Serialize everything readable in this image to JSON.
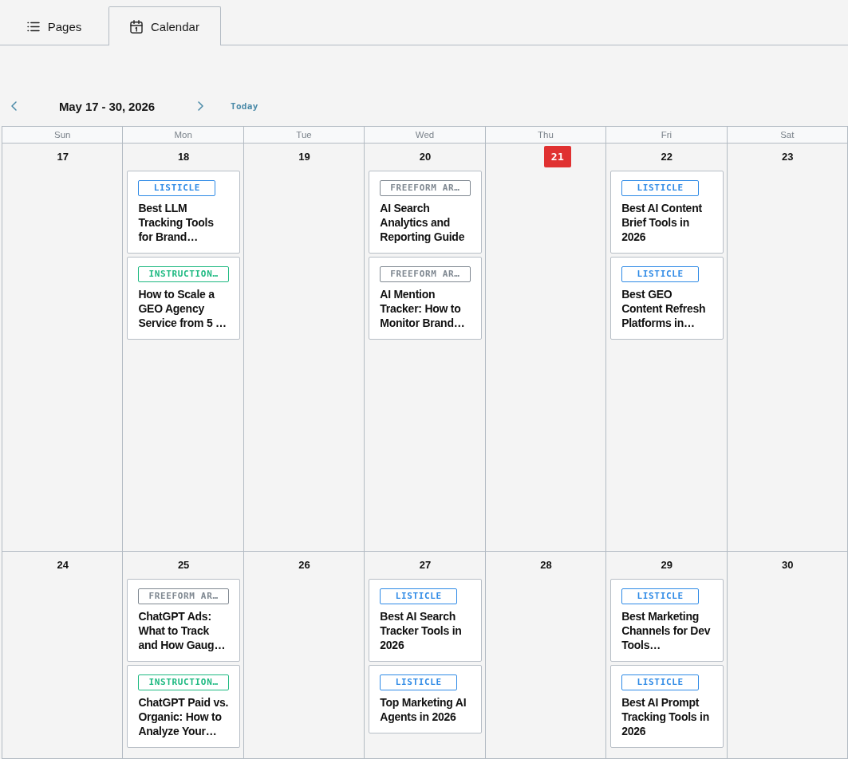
{
  "tabs": [
    {
      "label": "Pages",
      "selected": false
    },
    {
      "label": "Calendar",
      "selected": true
    }
  ],
  "navigation": {
    "range": "May 17 - 30, 2026",
    "today_button": "Today"
  },
  "calendar": {
    "weekdays": [
      "Sun",
      "Mon",
      "Tue",
      "Wed",
      "Thu",
      "Fri",
      "Sat"
    ],
    "weeks": [
      {
        "days": [
          {
            "date": "17",
            "today": false
          },
          {
            "date": "18",
            "today": false,
            "posts": [
              {
                "tag": "LISTICLE",
                "color": "#2e8ae6",
                "title": "Best LLM Tracking Tools for Brand…"
              },
              {
                "tag": "INSTRUCTION…",
                "color": "#1db981",
                "title": "How to Scale a GEO Agency Service from 5 …"
              }
            ]
          },
          {
            "date": "19",
            "today": false
          },
          {
            "date": "20",
            "today": false,
            "posts": [
              {
                "tag": "FREEFORM AR…",
                "color": "#7f8891",
                "title": "AI Search Analytics and Reporting Guide"
              },
              {
                "tag": "FREEFORM AR…",
                "color": "#7f8891",
                "title": "AI Mention Tracker: How to Monitor Brand…"
              }
            ]
          },
          {
            "date": "21",
            "today": true
          },
          {
            "date": "22",
            "today": false,
            "posts": [
              {
                "tag": "LISTICLE",
                "color": "#2e8ae6",
                "title": "Best AI Content Brief Tools in 2026"
              },
              {
                "tag": "LISTICLE",
                "color": "#2e8ae6",
                "title": "Best GEO Content Refresh Platforms in…"
              }
            ]
          },
          {
            "date": "23",
            "today": false
          }
        ]
      },
      {
        "days": [
          {
            "date": "24",
            "today": false
          },
          {
            "date": "25",
            "today": false,
            "posts": [
              {
                "tag": "FREEFORM AR…",
                "color": "#7f8891",
                "title": "ChatGPT Ads: What to Track and How Gaug…"
              },
              {
                "tag": "INSTRUCTION…",
                "color": "#1db981",
                "title": "ChatGPT Paid vs. Organic: How to Analyze Your…"
              }
            ]
          },
          {
            "date": "26",
            "today": false
          },
          {
            "date": "27",
            "today": false,
            "posts": [
              {
                "tag": "LISTICLE",
                "color": "#2e8ae6",
                "title": "Best AI Search Tracker Tools in 2026"
              },
              {
                "tag": "LISTICLE",
                "color": "#2e8ae6",
                "title": "Top Marketing AI Agents in 2026"
              }
            ]
          },
          {
            "date": "28",
            "today": false
          },
          {
            "date": "29",
            "today": false,
            "posts": [
              {
                "tag": "LISTICLE",
                "color": "#2e8ae6",
                "title": "Best Marketing Channels for Dev Tools…"
              },
              {
                "tag": "LISTICLE",
                "color": "#2e8ae6",
                "title": "Best AI Prompt Tracking Tools in 2026"
              }
            ]
          },
          {
            "date": "30",
            "today": false
          }
        ]
      }
    ]
  }
}
